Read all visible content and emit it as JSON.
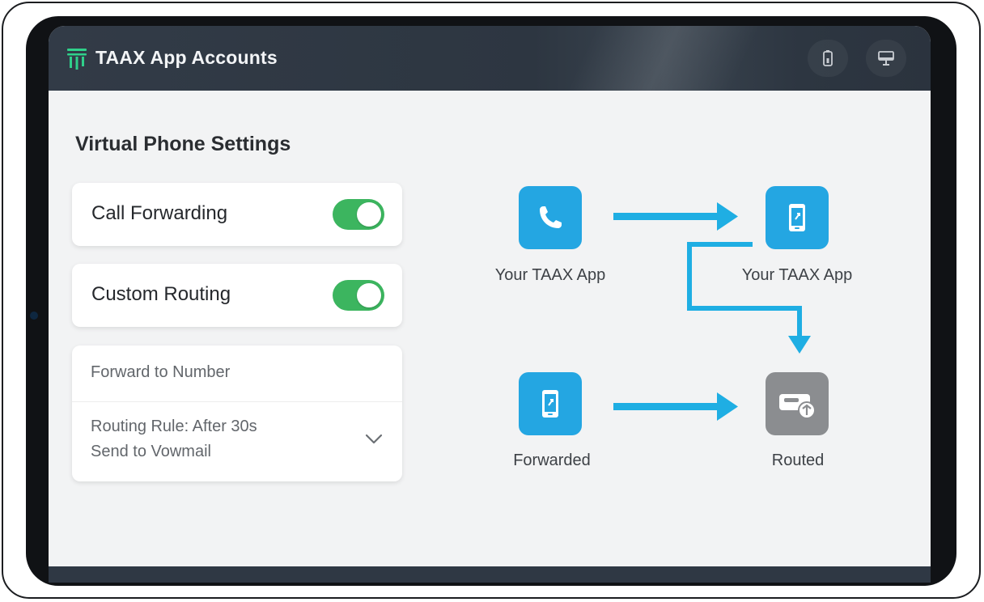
{
  "header": {
    "app_title": "TAAX App Accounts",
    "icons": [
      "logo-icon",
      "battery-icon",
      "monitor-icon"
    ]
  },
  "settings": {
    "section_title": "Virtual Phone Settings",
    "toggles": [
      {
        "label": "Call Forwarding",
        "state": "on"
      },
      {
        "label": "Custom Routing",
        "state": "on"
      }
    ],
    "forward_field_label": "Forward to Number",
    "routing_rule_line1": "Routing Rule: After 30s",
    "routing_rule_line2": "Send to Vowmail"
  },
  "flow": {
    "nodes": [
      {
        "label": "Your TAAX App",
        "icon": "phone-icon",
        "color": "#24a6e2"
      },
      {
        "label": "Your TAAX App",
        "icon": "mobile-icon",
        "color": "#24a6e2"
      },
      {
        "label": "Forwarded",
        "icon": "mobile-icon",
        "color": "#24a6e2"
      },
      {
        "label": "Routed",
        "icon": "voicemail-icon",
        "color": "#8b8d90"
      }
    ],
    "arrow_color": "#1faee3"
  },
  "colors": {
    "header_bg": "#2d3641",
    "toggle_on": "#3cb55f",
    "accent_blue": "#24a6e2"
  }
}
